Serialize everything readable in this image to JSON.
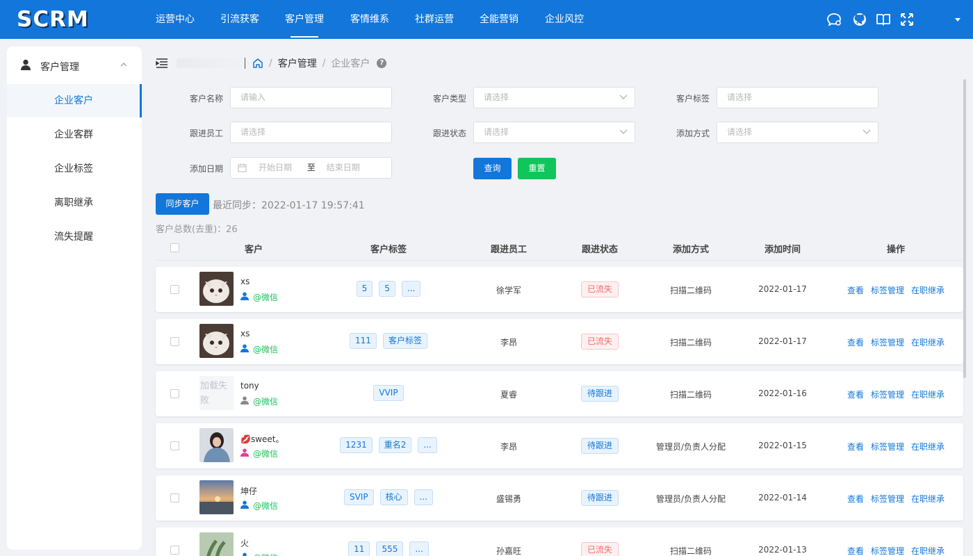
{
  "app": {
    "logo": "SCRM"
  },
  "nav": [
    {
      "label": "运营中心"
    },
    {
      "label": "引流获客"
    },
    {
      "label": "客户管理",
      "active": true
    },
    {
      "label": "客情维系"
    },
    {
      "label": "社群运营"
    },
    {
      "label": "全能营销"
    },
    {
      "label": "企业风控"
    }
  ],
  "top_icons": [
    "chat-icon",
    "github-icon",
    "book-icon",
    "fullscreen-icon",
    "caret-down-icon"
  ],
  "sidebar": {
    "header": "客户管理",
    "items": [
      {
        "label": "企业客户",
        "active": true
      },
      {
        "label": "企业客群"
      },
      {
        "label": "企业标签"
      },
      {
        "label": "离职继承"
      },
      {
        "label": "流失提醒"
      }
    ]
  },
  "breadcrumb": {
    "section": "客户管理",
    "current": "企业客户",
    "sep": "/"
  },
  "filters": {
    "name_label": "客户名称",
    "name_placeholder": "请输入",
    "type_label": "客户类型",
    "type_placeholder": "请选择",
    "tag_label": "客户标签",
    "tag_placeholder": "请选择",
    "employee_label": "跟进员工",
    "employee_placeholder": "请选择",
    "status_label": "跟进状态",
    "status_placeholder": "请选择",
    "method_label": "添加方式",
    "method_placeholder": "请选择",
    "date_label": "添加日期",
    "start_placeholder": "开始日期",
    "to": "至",
    "end_placeholder": "结束日期",
    "query": "查询",
    "reset": "重置"
  },
  "sync": {
    "button": "同步客户",
    "last": "最近同步：2022-01-17 19:57:41"
  },
  "total": "客户总数(去重)：26",
  "columns": [
    "客户",
    "客户标签",
    "跟进员工",
    "跟进状态",
    "添加方式",
    "添加时间",
    "操作"
  ],
  "actions": [
    "查看",
    "标签管理",
    "在职继承"
  ],
  "wechat_label": "@微信",
  "rows": [
    {
      "name": "xs",
      "avatar": "cat",
      "gender": "male",
      "tags": [
        "5",
        "5",
        "..."
      ],
      "employee": "徐学军",
      "status": "已流失",
      "status_type": "lost",
      "method": "扫描二维码",
      "date": "2022-01-17"
    },
    {
      "name": "xs",
      "avatar": "cat",
      "gender": "male",
      "tags": [
        "111",
        "客户标签"
      ],
      "employee": "李昂",
      "status": "已流失",
      "status_type": "lost",
      "method": "扫描二维码",
      "date": "2022-01-17"
    },
    {
      "name": "tony",
      "avatar": "fail",
      "avatar_text": "加载失败",
      "gender": "unknown",
      "tags": [
        "VVIP"
      ],
      "employee": "夏睿",
      "status": "待跟进",
      "status_type": "wait",
      "method": "扫描二维码",
      "date": "2022-01-16"
    },
    {
      "name": "💋sweet。",
      "avatar": "girl",
      "gender": "female",
      "tags": [
        "1231",
        "重名2",
        "..."
      ],
      "employee": "李昂",
      "status": "待跟进",
      "status_type": "wait",
      "method": "管理员/负责人分配",
      "date": "2022-01-15"
    },
    {
      "name": "坤仔",
      "avatar": "sunset",
      "gender": "male",
      "tags": [
        "SVIP",
        "核心",
        "..."
      ],
      "employee": "盛锡勇",
      "status": "待跟进",
      "status_type": "wait",
      "method": "管理员/负责人分配",
      "date": "2022-01-14"
    },
    {
      "name": "火",
      "avatar": "plant",
      "gender": "male",
      "tags": [
        "11",
        "555",
        "..."
      ],
      "employee": "孙嘉旺",
      "status": "已流失",
      "status_type": "lost",
      "method": "扫描二维码",
      "date": "2022-01-13"
    }
  ],
  "colors": {
    "primary": "#1276db",
    "success": "#10c55b",
    "danger": "#f56c6c",
    "wechat": "#19c35b"
  }
}
